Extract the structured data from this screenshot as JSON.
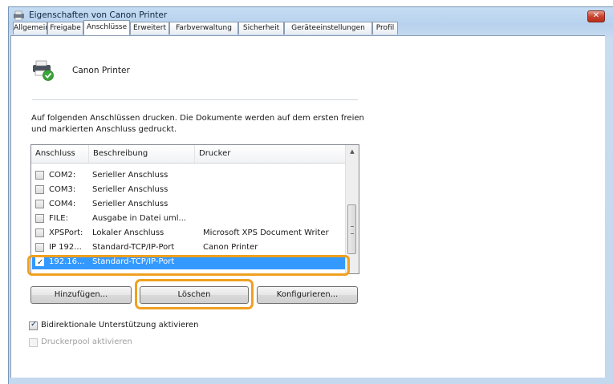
{
  "window": {
    "title": "Eigenschaften von Canon Printer",
    "close_label": "✕"
  },
  "tabs": [
    "Allgemein",
    "Freigabe",
    "Anschlüsse",
    "Erweitert",
    "Farbverwaltung",
    "Sicherheit",
    "Geräteeinstellungen",
    "Profil"
  ],
  "printer": {
    "name": "Canon Printer"
  },
  "description": "Auf folgenden Anschlüssen drucken. Die Dokumente werden auf dem ersten freien und markierten Anschluss gedruckt.",
  "ports": {
    "columns": [
      "Anschluss",
      "Beschreibung",
      "Drucker"
    ],
    "rows": [
      {
        "port": "COM2:",
        "desc": "Serieller Anschluss",
        "printer": "",
        "checked": false,
        "selected": false
      },
      {
        "port": "COM3:",
        "desc": "Serieller Anschluss",
        "printer": "",
        "checked": false,
        "selected": false
      },
      {
        "port": "COM4:",
        "desc": "Serieller Anschluss",
        "printer": "",
        "checked": false,
        "selected": false
      },
      {
        "port": "FILE:",
        "desc": "Ausgabe in Datei uml...",
        "printer": "",
        "checked": false,
        "selected": false
      },
      {
        "port": "XPSPort:",
        "desc": "Lokaler Anschluss",
        "printer": "Microsoft XPS Document Writer",
        "checked": false,
        "selected": false
      },
      {
        "port": "IP 192...",
        "desc": "Standard-TCP/IP-Port",
        "printer": "Canon Printer",
        "checked": false,
        "selected": false
      },
      {
        "port": "192.16...",
        "desc": "Standard-TCP/IP-Port",
        "printer": "",
        "checked": true,
        "selected": true
      }
    ]
  },
  "buttons": {
    "add": "Hinzufügen...",
    "delete": "Löschen",
    "configure": "Konfigurieren..."
  },
  "options": {
    "bidirectional": {
      "label": "Bidirektionale Unterstützung aktivieren",
      "checked": true
    },
    "pool": {
      "label": "Druckerpool aktivieren",
      "checked": false,
      "enabled": false
    }
  },
  "colors": {
    "selection": "#3399ff",
    "highlight": "#f0a020"
  },
  "icons": {
    "close": "close-icon",
    "printer": "printer-icon",
    "check": "check-icon",
    "scroll_up": "scroll-up-icon"
  }
}
